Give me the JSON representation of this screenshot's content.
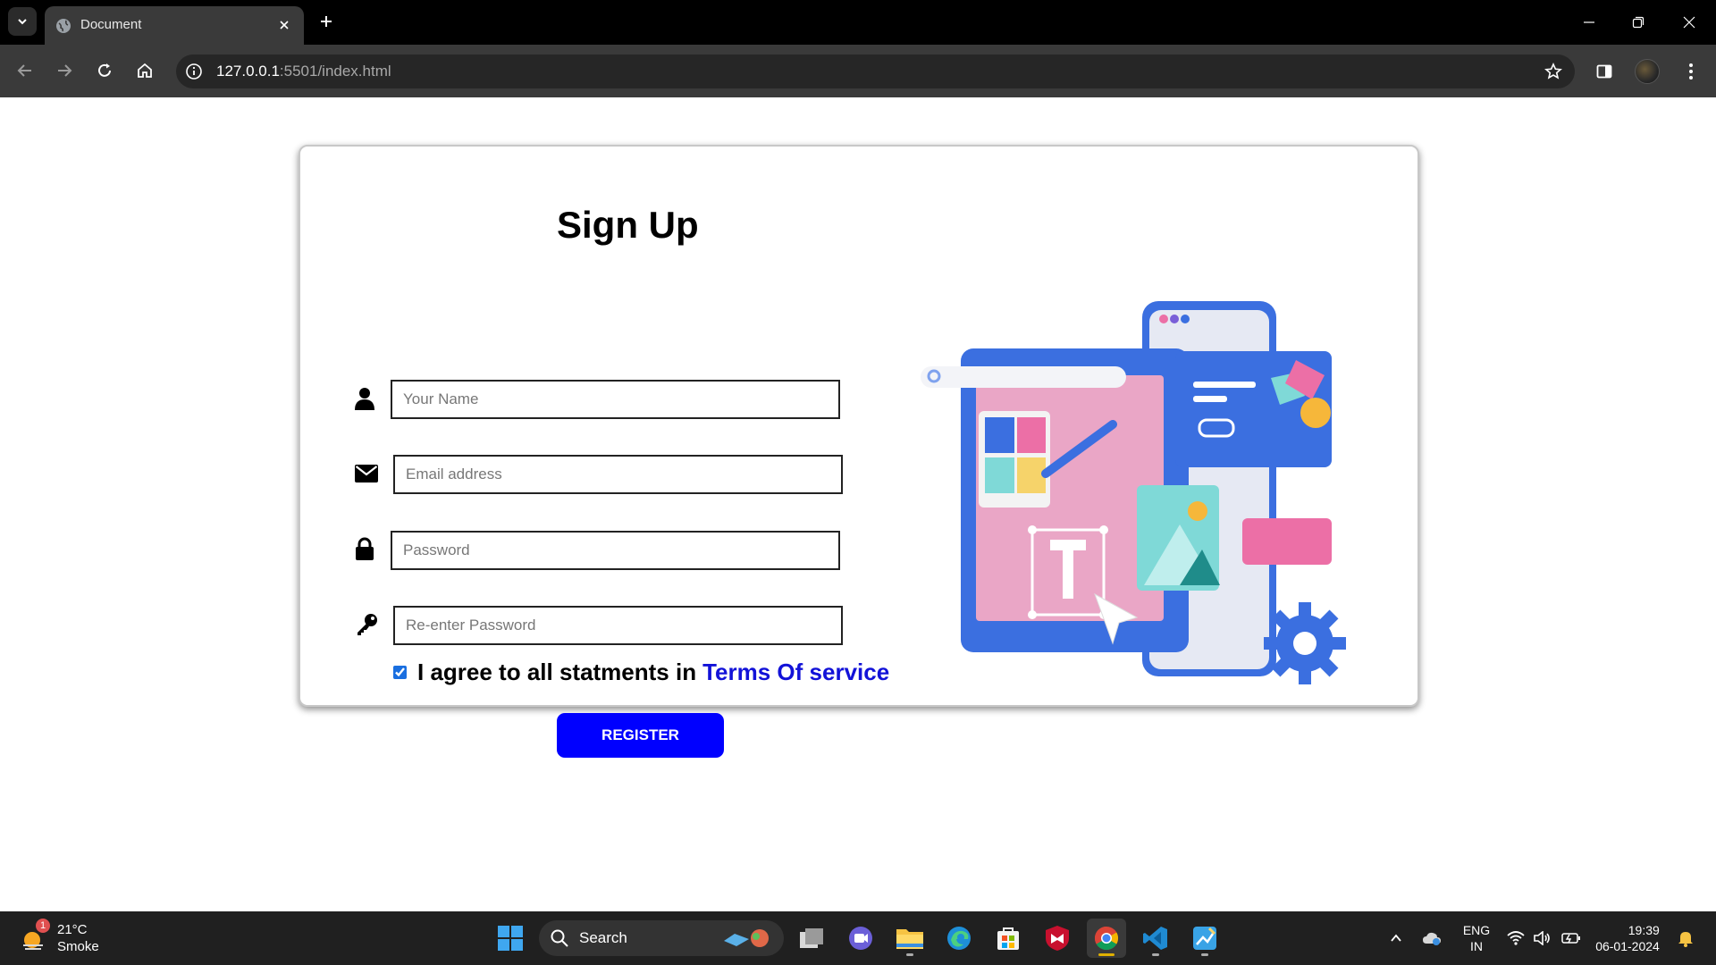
{
  "browser": {
    "tab_title": "Document",
    "url_host": "127.0.0.1",
    "url_path": ":5501/index.html"
  },
  "form": {
    "title": "Sign Up",
    "name_placeholder": "Your Name",
    "email_placeholder": "Email address",
    "password_placeholder": "Password",
    "repassword_placeholder": "Re-enter Password",
    "agree_text": "I agree to all statments in",
    "terms_link": "Terms Of service",
    "agree_checked": true,
    "register_label": "REGISTER"
  },
  "taskbar": {
    "weather_badge": "1",
    "weather_temp": "21°C",
    "weather_condition": "Smoke",
    "search_label": "Search",
    "lang_top": "ENG",
    "lang_bottom": "IN",
    "time": "19:39",
    "date": "06-01-2024"
  },
  "colors": {
    "register_button": "#0000ff",
    "terms_link": "#1212d8",
    "illustration_blue": "#3b6fe0",
    "illustration_pink": "#ec6fa6"
  }
}
